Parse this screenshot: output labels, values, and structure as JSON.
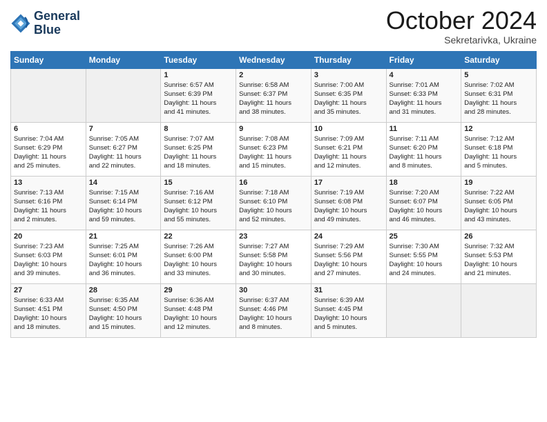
{
  "header": {
    "logo_line1": "General",
    "logo_line2": "Blue",
    "month": "October 2024",
    "location": "Sekretarivka, Ukraine"
  },
  "weekdays": [
    "Sunday",
    "Monday",
    "Tuesday",
    "Wednesday",
    "Thursday",
    "Friday",
    "Saturday"
  ],
  "weeks": [
    [
      {
        "day": "",
        "text": ""
      },
      {
        "day": "",
        "text": ""
      },
      {
        "day": "1",
        "text": "Sunrise: 6:57 AM\nSunset: 6:39 PM\nDaylight: 11 hours\nand 41 minutes."
      },
      {
        "day": "2",
        "text": "Sunrise: 6:58 AM\nSunset: 6:37 PM\nDaylight: 11 hours\nand 38 minutes."
      },
      {
        "day": "3",
        "text": "Sunrise: 7:00 AM\nSunset: 6:35 PM\nDaylight: 11 hours\nand 35 minutes."
      },
      {
        "day": "4",
        "text": "Sunrise: 7:01 AM\nSunset: 6:33 PM\nDaylight: 11 hours\nand 31 minutes."
      },
      {
        "day": "5",
        "text": "Sunrise: 7:02 AM\nSunset: 6:31 PM\nDaylight: 11 hours\nand 28 minutes."
      }
    ],
    [
      {
        "day": "6",
        "text": "Sunrise: 7:04 AM\nSunset: 6:29 PM\nDaylight: 11 hours\nand 25 minutes."
      },
      {
        "day": "7",
        "text": "Sunrise: 7:05 AM\nSunset: 6:27 PM\nDaylight: 11 hours\nand 22 minutes."
      },
      {
        "day": "8",
        "text": "Sunrise: 7:07 AM\nSunset: 6:25 PM\nDaylight: 11 hours\nand 18 minutes."
      },
      {
        "day": "9",
        "text": "Sunrise: 7:08 AM\nSunset: 6:23 PM\nDaylight: 11 hours\nand 15 minutes."
      },
      {
        "day": "10",
        "text": "Sunrise: 7:09 AM\nSunset: 6:21 PM\nDaylight: 11 hours\nand 12 minutes."
      },
      {
        "day": "11",
        "text": "Sunrise: 7:11 AM\nSunset: 6:20 PM\nDaylight: 11 hours\nand 8 minutes."
      },
      {
        "day": "12",
        "text": "Sunrise: 7:12 AM\nSunset: 6:18 PM\nDaylight: 11 hours\nand 5 minutes."
      }
    ],
    [
      {
        "day": "13",
        "text": "Sunrise: 7:13 AM\nSunset: 6:16 PM\nDaylight: 11 hours\nand 2 minutes."
      },
      {
        "day": "14",
        "text": "Sunrise: 7:15 AM\nSunset: 6:14 PM\nDaylight: 10 hours\nand 59 minutes."
      },
      {
        "day": "15",
        "text": "Sunrise: 7:16 AM\nSunset: 6:12 PM\nDaylight: 10 hours\nand 55 minutes."
      },
      {
        "day": "16",
        "text": "Sunrise: 7:18 AM\nSunset: 6:10 PM\nDaylight: 10 hours\nand 52 minutes."
      },
      {
        "day": "17",
        "text": "Sunrise: 7:19 AM\nSunset: 6:08 PM\nDaylight: 10 hours\nand 49 minutes."
      },
      {
        "day": "18",
        "text": "Sunrise: 7:20 AM\nSunset: 6:07 PM\nDaylight: 10 hours\nand 46 minutes."
      },
      {
        "day": "19",
        "text": "Sunrise: 7:22 AM\nSunset: 6:05 PM\nDaylight: 10 hours\nand 43 minutes."
      }
    ],
    [
      {
        "day": "20",
        "text": "Sunrise: 7:23 AM\nSunset: 6:03 PM\nDaylight: 10 hours\nand 39 minutes."
      },
      {
        "day": "21",
        "text": "Sunrise: 7:25 AM\nSunset: 6:01 PM\nDaylight: 10 hours\nand 36 minutes."
      },
      {
        "day": "22",
        "text": "Sunrise: 7:26 AM\nSunset: 6:00 PM\nDaylight: 10 hours\nand 33 minutes."
      },
      {
        "day": "23",
        "text": "Sunrise: 7:27 AM\nSunset: 5:58 PM\nDaylight: 10 hours\nand 30 minutes."
      },
      {
        "day": "24",
        "text": "Sunrise: 7:29 AM\nSunset: 5:56 PM\nDaylight: 10 hours\nand 27 minutes."
      },
      {
        "day": "25",
        "text": "Sunrise: 7:30 AM\nSunset: 5:55 PM\nDaylight: 10 hours\nand 24 minutes."
      },
      {
        "day": "26",
        "text": "Sunrise: 7:32 AM\nSunset: 5:53 PM\nDaylight: 10 hours\nand 21 minutes."
      }
    ],
    [
      {
        "day": "27",
        "text": "Sunrise: 6:33 AM\nSunset: 4:51 PM\nDaylight: 10 hours\nand 18 minutes."
      },
      {
        "day": "28",
        "text": "Sunrise: 6:35 AM\nSunset: 4:50 PM\nDaylight: 10 hours\nand 15 minutes."
      },
      {
        "day": "29",
        "text": "Sunrise: 6:36 AM\nSunset: 4:48 PM\nDaylight: 10 hours\nand 12 minutes."
      },
      {
        "day": "30",
        "text": "Sunrise: 6:37 AM\nSunset: 4:46 PM\nDaylight: 10 hours\nand 8 minutes."
      },
      {
        "day": "31",
        "text": "Sunrise: 6:39 AM\nSunset: 4:45 PM\nDaylight: 10 hours\nand 5 minutes."
      },
      {
        "day": "",
        "text": ""
      },
      {
        "day": "",
        "text": ""
      }
    ]
  ]
}
